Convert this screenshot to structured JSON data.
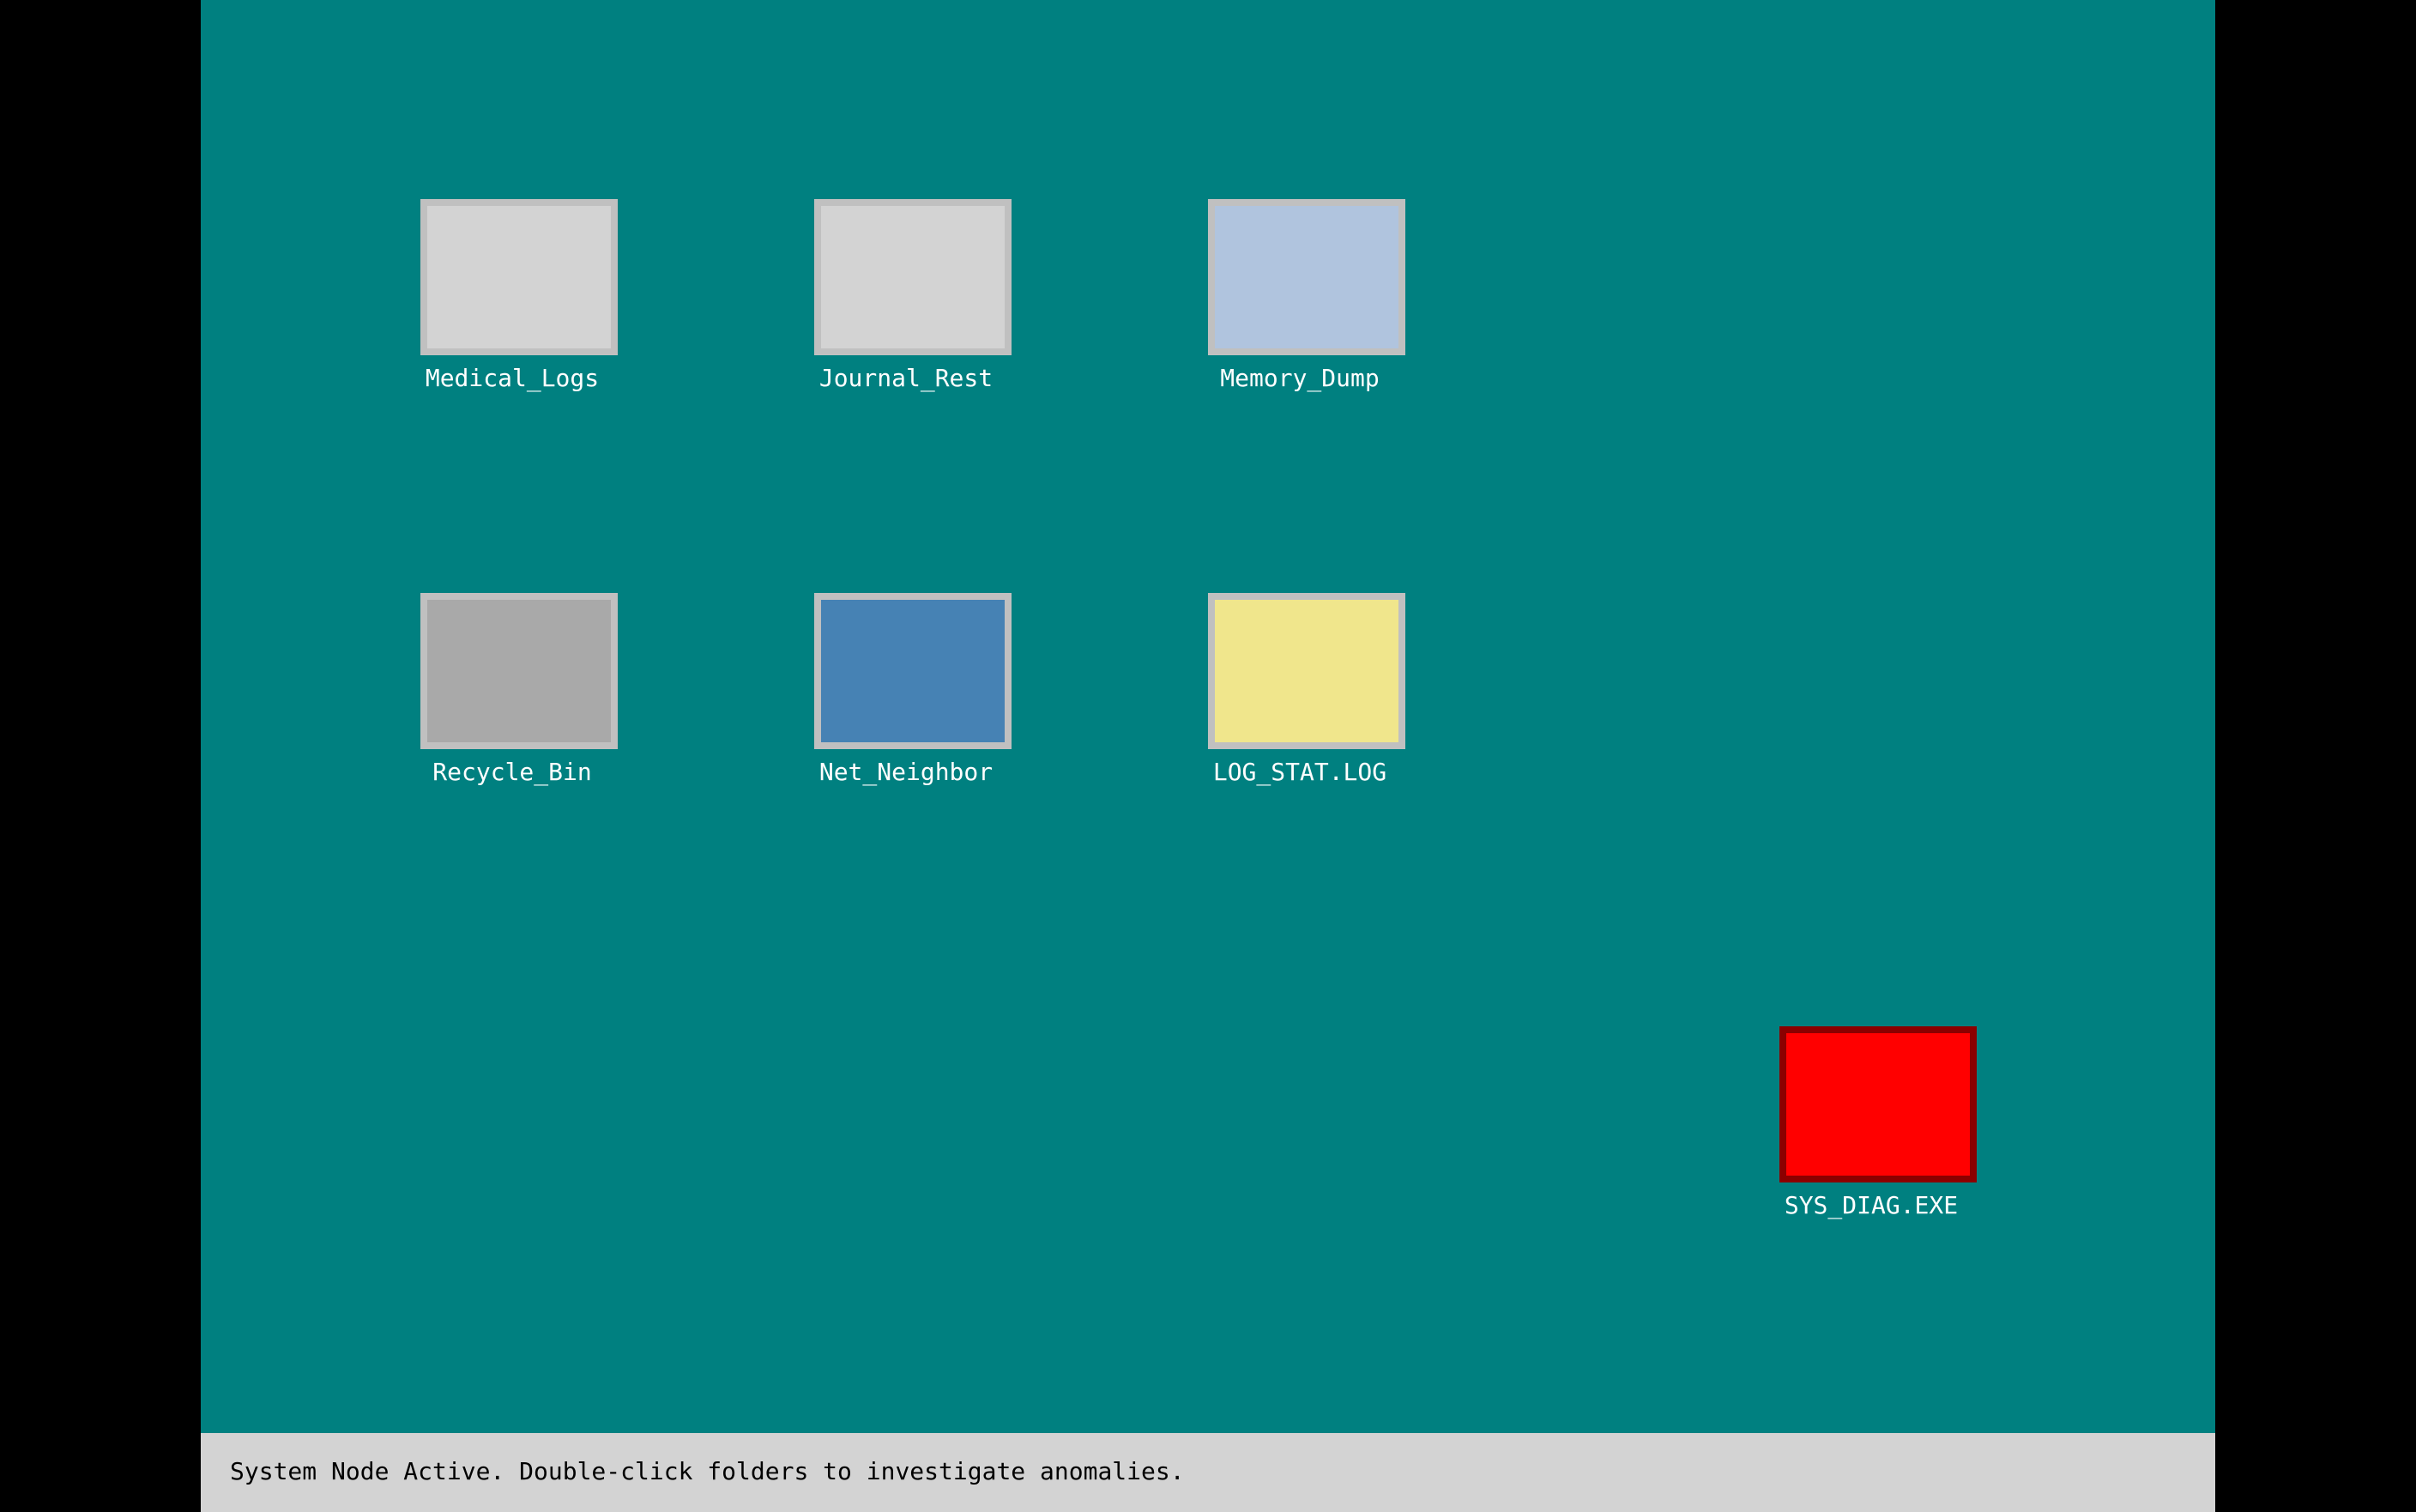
{
  "desktop": {
    "background_color": "#008080",
    "icons": [
      {
        "label": "Medical_Logs",
        "icon": "folder-icon",
        "color": "#d3d3d3",
        "border_color": "#c0c0c0"
      },
      {
        "label": "Journal_Rest",
        "icon": "folder-icon",
        "color": "#d3d3d3",
        "border_color": "#c0c0c0"
      },
      {
        "label": "Memory_Dump",
        "icon": "folder-icon",
        "color": "#b0c4de",
        "border_color": "#c0c0c0"
      },
      {
        "label": "Recycle_Bin",
        "icon": "recycle-bin-icon",
        "color": "#a9a9a9",
        "border_color": "#c0c0c0"
      },
      {
        "label": "Net_Neighbor",
        "icon": "network-icon",
        "color": "#4682b4",
        "border_color": "#c0c0c0"
      },
      {
        "label": "LOG_STAT.LOG",
        "icon": "log-file-icon",
        "color": "#f0e68c",
        "border_color": "#c0c0c0"
      },
      {
        "label": "SYS_DIAG.EXE",
        "icon": "executable-icon",
        "color": "#ff0000",
        "border_color": "#8b0000"
      }
    ]
  },
  "status_bar": {
    "text": "System Node Active. Double-click folders to investigate anomalies.",
    "background_color": "#d3d3d3"
  }
}
